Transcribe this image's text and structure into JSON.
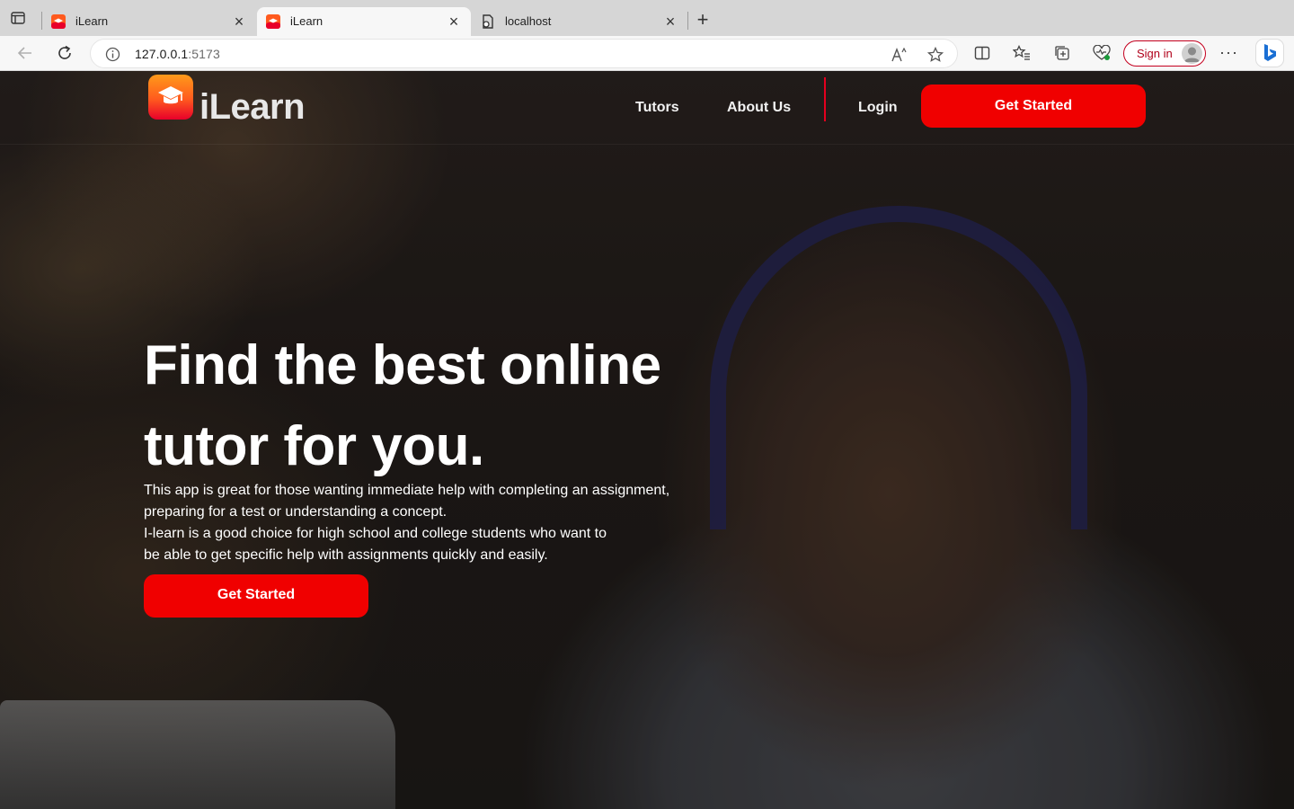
{
  "browser": {
    "tabs": [
      {
        "title": "iLearn",
        "icon": "ilearn-favicon",
        "active": false
      },
      {
        "title": "iLearn",
        "icon": "ilearn-favicon",
        "active": true
      },
      {
        "title": "localhost",
        "icon": "page-icon",
        "active": false
      }
    ],
    "new_tab_label": "+",
    "close_glyph": "×",
    "url_host": "127.0.0.1",
    "url_port": ":5173",
    "sign_in_label": "Sign in",
    "more_label": "···"
  },
  "site": {
    "brand": "iLearn",
    "nav": {
      "tutors": "Tutors",
      "about": "About Us",
      "login": "Login",
      "get_started": "Get Started"
    },
    "hero": {
      "headline_line1": "Find the best online",
      "headline_line2": "tutor for you.",
      "desc_line1": "This app is great for those wanting immediate help with completing an assignment,",
      "desc_line2": "preparing for a test or understanding a concept.",
      "desc_line3": "I-learn is a good choice for high school and college students who want to",
      "desc_line4": "be able to get specific help with assignments quickly and easily.",
      "cta": "Get Started"
    },
    "colors": {
      "accent": "#f00000",
      "divider": "#e4001e",
      "logo_gradient_top": "#ff9a1a",
      "logo_gradient_bottom": "#e8002a"
    }
  }
}
